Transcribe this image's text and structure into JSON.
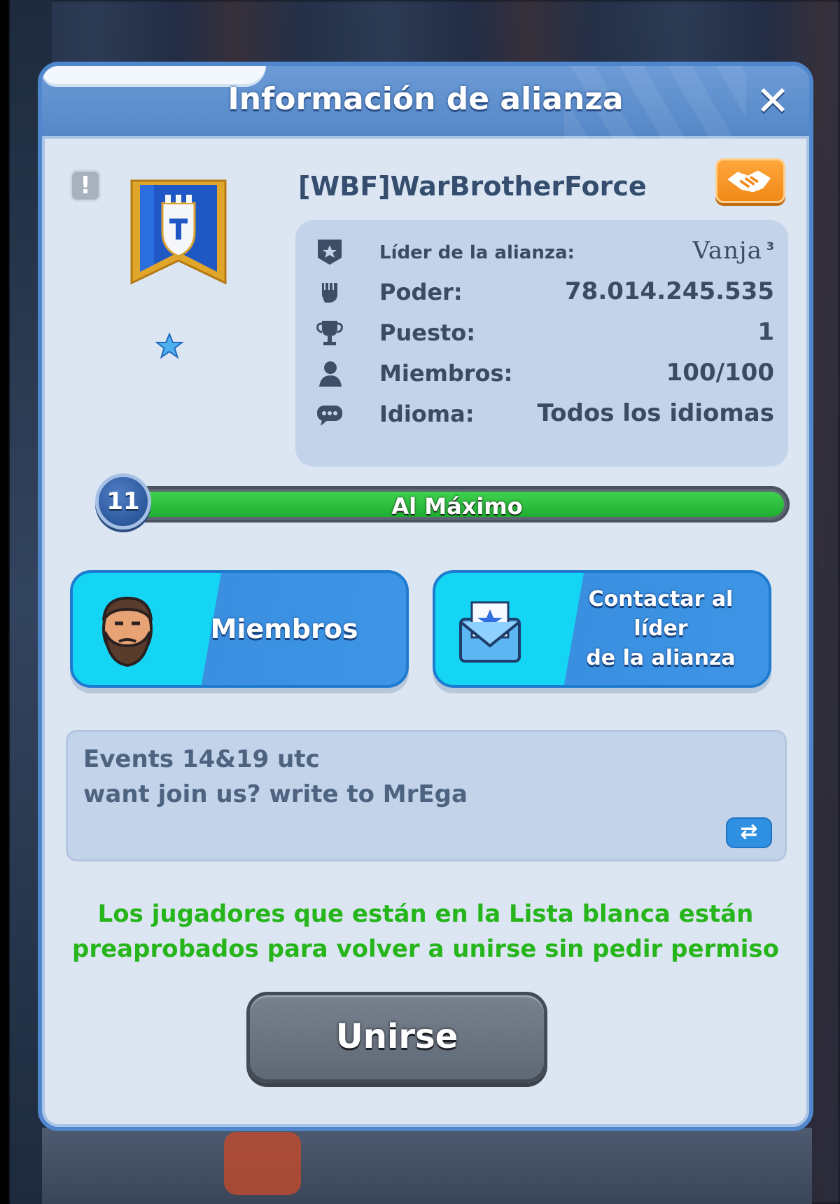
{
  "dialog": {
    "title": "Información de alianza",
    "close_symbol": "✕"
  },
  "alliance": {
    "name": "[WBF]WarBrotherForce",
    "report_symbol": "!",
    "info": {
      "leader_label": "Líder de la alianza:",
      "leader_value": "Vanja",
      "leader_sup": "3",
      "power_label": "Poder:",
      "power_value": "78.014.245.535",
      "rank_label": "Puesto:",
      "rank_value": "1",
      "members_label": "Miembros:",
      "members_value": "100/100",
      "language_label": "Idioma:",
      "language_value": "Todos los idiomas"
    },
    "level": {
      "number": "11",
      "label": "Al Máximo",
      "progress": 1.0
    }
  },
  "buttons": {
    "members_label": "Miembros",
    "contact_label_line1": "Contactar al líder",
    "contact_label_line2": "de la alianza",
    "join_label": "Unirse",
    "translate_symbol": "⇄"
  },
  "description": {
    "line1": "Events 14&19 utc",
    "line2": "want join us? write to MrEga"
  },
  "notice": {
    "line1": "Los jugadores que están en la Lista blanca están",
    "line2": "preaprobados para volver a unirse sin pedir permiso"
  },
  "colors": {
    "accent_blue": "#4f86cc",
    "notice_green": "#27b51c",
    "diplomacy_orange": "#f08918",
    "level_green": "#1fae31"
  },
  "icons": {
    "report": "report-icon",
    "leader": "leader-banner-icon",
    "power": "fist-icon",
    "rank": "trophy-icon",
    "members": "person-icon",
    "language": "chat-bubble-icon",
    "diplomacy": "handshake-icon",
    "members_button": "bearded-man-icon",
    "contact_button": "envelope-star-icon",
    "translate": "translate-arrows-icon"
  }
}
